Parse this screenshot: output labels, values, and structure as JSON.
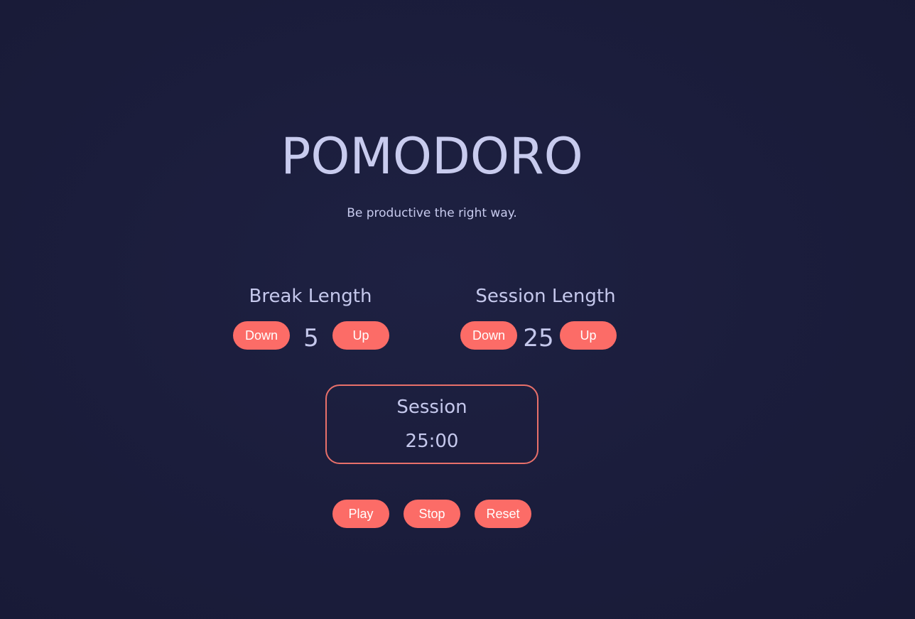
{
  "header": {
    "title": "POMODORO",
    "subtitle": "Be productive the right way."
  },
  "break_control": {
    "label": "Break Length",
    "down_label": "Down",
    "up_label": "Up",
    "value": "5"
  },
  "session_control": {
    "label": "Session Length",
    "down_label": "Down",
    "up_label": "Up",
    "value": "25"
  },
  "timer": {
    "label": "Session",
    "time": "25:00"
  },
  "actions": {
    "play_label": "Play",
    "stop_label": "Stop",
    "reset_label": "Reset"
  },
  "colors": {
    "background": "#1b1d3c",
    "text": "#c5c8ec",
    "accent": "#fc6c67",
    "button_text": "#ffffff"
  }
}
